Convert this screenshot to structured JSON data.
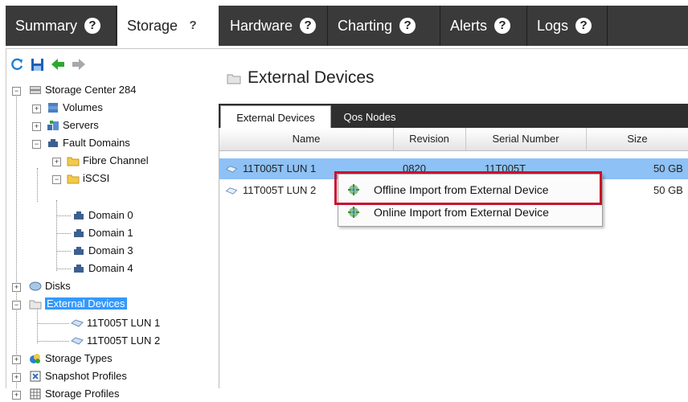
{
  "top_tabs": [
    {
      "label": "Summary",
      "help": "?"
    },
    {
      "label": "Storage",
      "help": "?"
    },
    {
      "label": "Hardware",
      "help": "?"
    },
    {
      "label": "Charting",
      "help": "?"
    },
    {
      "label": "Alerts",
      "help": "?"
    },
    {
      "label": "Logs",
      "help": "?"
    }
  ],
  "toolbar": {
    "icons": [
      "refresh-icon",
      "save-icon",
      "back-arrow-icon",
      "forward-arrow-icon"
    ]
  },
  "tree": {
    "root": "Storage Center 284",
    "volumes": "Volumes",
    "servers": "Servers",
    "fault_domains": "Fault Domains",
    "fibre_channel": "Fibre Channel",
    "iscsi": "iSCSI",
    "domains": [
      "Domain 0",
      "Domain 1",
      "Domain 3",
      "Domain 4"
    ],
    "disks": "Disks",
    "external_devices": "External Devices",
    "ext_children": [
      "11T005T LUN 1",
      "11T005T LUN 2"
    ],
    "storage_types": "Storage Types",
    "snapshot_profiles": "Snapshot Profiles",
    "storage_profiles": "Storage Profiles"
  },
  "main": {
    "title": "External Devices",
    "tabs": [
      "External Devices",
      "Qos Nodes"
    ],
    "columns": [
      "Name",
      "Revision",
      "Serial Number",
      "Size"
    ],
    "rows": [
      {
        "name": "11T005T LUN 1",
        "revision": "0820",
        "serial": "11T005T",
        "size": "50 GB"
      },
      {
        "name": "11T005T LUN 2",
        "revision": "",
        "serial": "",
        "size": "50 GB"
      }
    ]
  },
  "context_menu": {
    "items": [
      "Offline Import from External Device",
      "Online Import from External Device"
    ]
  },
  "colors": {
    "tab_bar": "#3a3a3a",
    "selection": "#3399ff",
    "highlight_box": "#c8102e"
  }
}
